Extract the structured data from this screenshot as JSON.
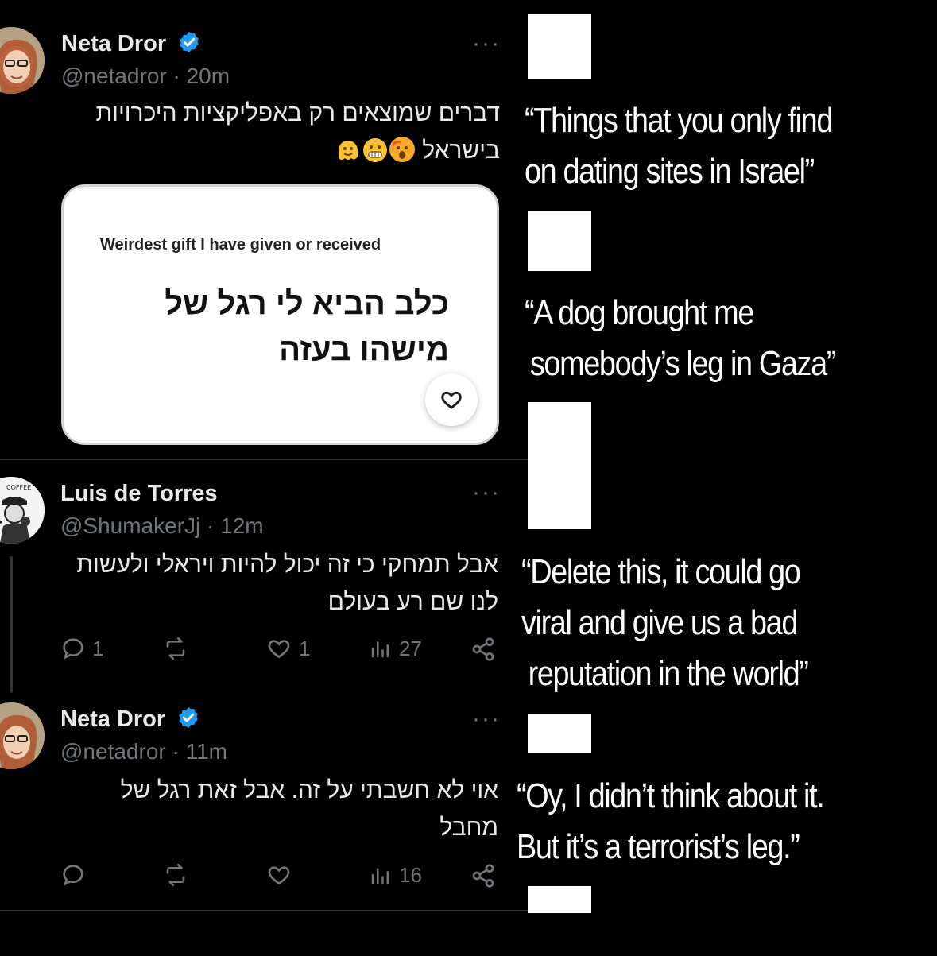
{
  "tweets": [
    {
      "author": "Neta Dror",
      "handle": "@netadror",
      "time": "20m",
      "text_line1": "דברים שמוצאים רק באפליקציות היכרויות",
      "text_line2": "בישראל",
      "emoji_icons": [
        "face-with-open-mouth-icon",
        "grimacing-face-icon",
        "melting-face-icon"
      ],
      "card": {
        "prompt": "Weirdest gift I have given or received",
        "answer": "כלב הביא לי רגל של מישהו בעזה"
      }
    },
    {
      "author": "Luis de Torres",
      "handle": "@ShumakerJj",
      "time": "12m",
      "text": "אבל תמחקי כי זה יכול להיות ויראלי ולעשות לנו שם רע בעולם",
      "replies": "1",
      "reposts": "",
      "likes": "1",
      "views": "27"
    },
    {
      "author": "Neta Dror",
      "handle": "@netadror",
      "time": "11m",
      "text": "אוי לא חשבתי על זה. אבל זאת רגל של מחבל",
      "replies": "",
      "reposts": "",
      "likes": "",
      "views": "16"
    }
  ],
  "translations": [
    {
      "line1": "“Things that you only find",
      "line2": "on dating sites in Israel”"
    },
    {
      "line1": "“A dog brought me",
      "line2": "somebody’s leg in Gaza”"
    },
    {
      "line1": "“Delete this, it could go",
      "line2": "viral and give us a bad",
      "line3": "reputation in the world”"
    },
    {
      "line1": "“Oy, I didn’t think about it.",
      "line2": "But it’s a terrorist’s leg.”"
    }
  ],
  "colors": {
    "background": "#000000",
    "text": "#e7e9ea",
    "muted": "#71767b",
    "verified": "#1d9bf0",
    "divider": "#2f3336"
  },
  "separator": "·"
}
